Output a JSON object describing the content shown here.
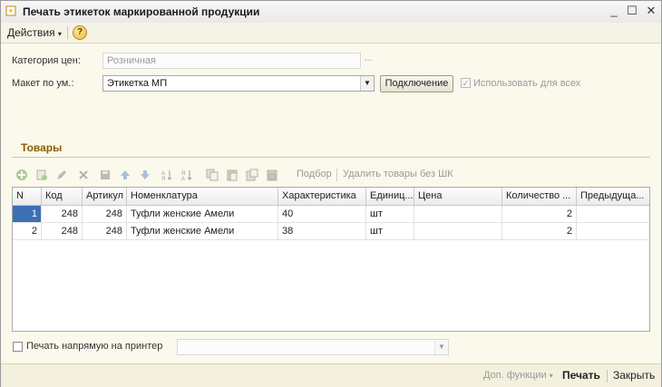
{
  "window": {
    "title": "Печать этикеток маркированной продукции",
    "buttons": {
      "minimize": "_",
      "maximize": "☐",
      "close": "✕"
    }
  },
  "cmdbar": {
    "actions_label": "Действия",
    "help_label": "?"
  },
  "form": {
    "price_category_label": "Категория цен:",
    "price_category_value": "Розничная",
    "layout_label": "Макет по ум.:",
    "layout_value": "Этикетка МП",
    "connect_button": "Подключение",
    "use_for_all_label": "Использовать для всех",
    "use_for_all_checked": true
  },
  "goods": {
    "group_title": "Товары",
    "toolbar": {
      "icons": [
        "add-icon",
        "copy-row-icon",
        "edit-icon",
        "delete-icon",
        "save-icon",
        "move-up-icon",
        "move-down-icon",
        "sort-asc-icon",
        "sort-desc-icon",
        "copy-icon",
        "paste-icon",
        "paste-special-icon",
        "clipboard-icon"
      ],
      "selection_label": "Подбор",
      "remove_without_barcode_label": "Удалить товары без ШК"
    },
    "columns": [
      "N",
      "Код",
      "Артикул",
      "Номенклатура",
      "Характеристика",
      "Единиц...",
      "Цена",
      "Количество ...",
      "Предыдуща..."
    ],
    "rows": [
      {
        "n": "1",
        "code": "248",
        "article": "248",
        "name": "Туфли  женские Амели",
        "characteristic": "40",
        "unit": "шт",
        "price": "",
        "qty": "2",
        "prev": ""
      },
      {
        "n": "2",
        "code": "248",
        "article": "248",
        "name": "Туфли  женские Амели",
        "characteristic": "38",
        "unit": "шт",
        "price": "",
        "qty": "2",
        "prev": ""
      }
    ]
  },
  "print_direct": {
    "label": "Печать напрямую на принтер",
    "checked": false,
    "printer_value": ""
  },
  "footer": {
    "extra_functions": "Доп. функции",
    "print": "Печать",
    "close": "Закрыть"
  },
  "colors": {
    "selection": "#3d6fb6",
    "group_title": "#8c5d00",
    "background": "#fbf9ec"
  }
}
